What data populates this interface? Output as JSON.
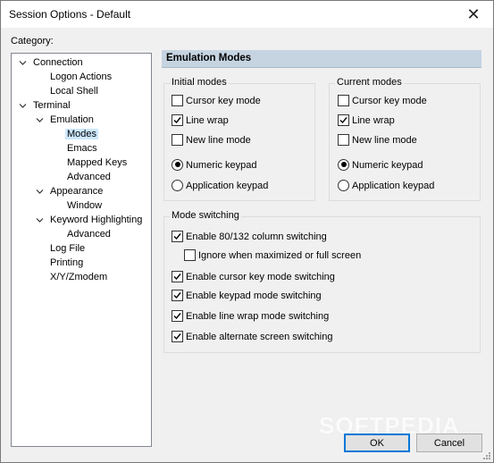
{
  "window": {
    "title": "Session Options - Default",
    "close_glyph": "✕"
  },
  "category": {
    "label": "Category:",
    "tree": [
      {
        "label": "Connection",
        "level": 0,
        "expanded": true
      },
      {
        "label": "Logon Actions",
        "level": 1
      },
      {
        "label": "Local Shell",
        "level": 1
      },
      {
        "label": "Terminal",
        "level": 0,
        "expanded": true
      },
      {
        "label": "Emulation",
        "level": 1,
        "expanded": true
      },
      {
        "label": "Modes",
        "level": 2,
        "selected": true
      },
      {
        "label": "Emacs",
        "level": 2
      },
      {
        "label": "Mapped Keys",
        "level": 2
      },
      {
        "label": "Advanced",
        "level": 2
      },
      {
        "label": "Appearance",
        "level": 1,
        "expanded": true
      },
      {
        "label": "Window",
        "level": 2
      },
      {
        "label": "Keyword Highlighting",
        "level": 1,
        "expanded": true
      },
      {
        "label": "Advanced",
        "level": 2
      },
      {
        "label": "Log File",
        "level": 1
      },
      {
        "label": "Printing",
        "level": 1
      },
      {
        "label": "X/Y/Zmodem",
        "level": 1
      }
    ]
  },
  "panel": {
    "header": "Emulation Modes",
    "initial_modes": {
      "title": "Initial modes",
      "cursor_key_mode": {
        "label": "Cursor key mode",
        "checked": false
      },
      "line_wrap": {
        "label": "Line wrap",
        "checked": true
      },
      "new_line_mode": {
        "label": "New line mode",
        "checked": false
      },
      "numeric_keypad": {
        "label": "Numeric keypad",
        "selected": true
      },
      "application_keypad": {
        "label": "Application keypad",
        "selected": false
      }
    },
    "current_modes": {
      "title": "Current modes",
      "cursor_key_mode": {
        "label": "Cursor key mode",
        "checked": false
      },
      "line_wrap": {
        "label": "Line wrap",
        "checked": true
      },
      "new_line_mode": {
        "label": "New line mode",
        "checked": false
      },
      "numeric_keypad": {
        "label": "Numeric keypad",
        "selected": true
      },
      "application_keypad": {
        "label": "Application keypad",
        "selected": false
      }
    },
    "mode_switching": {
      "title": "Mode switching",
      "enable_80_132": {
        "label": "Enable 80/132 column switching",
        "checked": true
      },
      "ignore_maximized": {
        "label": "Ignore when maximized or full screen",
        "checked": false
      },
      "enable_cursor_key": {
        "label": "Enable cursor key mode switching",
        "checked": true
      },
      "enable_keypad": {
        "label": "Enable keypad mode switching",
        "checked": true
      },
      "enable_line_wrap": {
        "label": "Enable line wrap mode switching",
        "checked": true
      },
      "enable_alt_screen": {
        "label": "Enable alternate screen switching",
        "checked": true
      }
    }
  },
  "buttons": {
    "ok": "OK",
    "cancel": "Cancel"
  },
  "watermark": "SOFTPEDIA"
}
